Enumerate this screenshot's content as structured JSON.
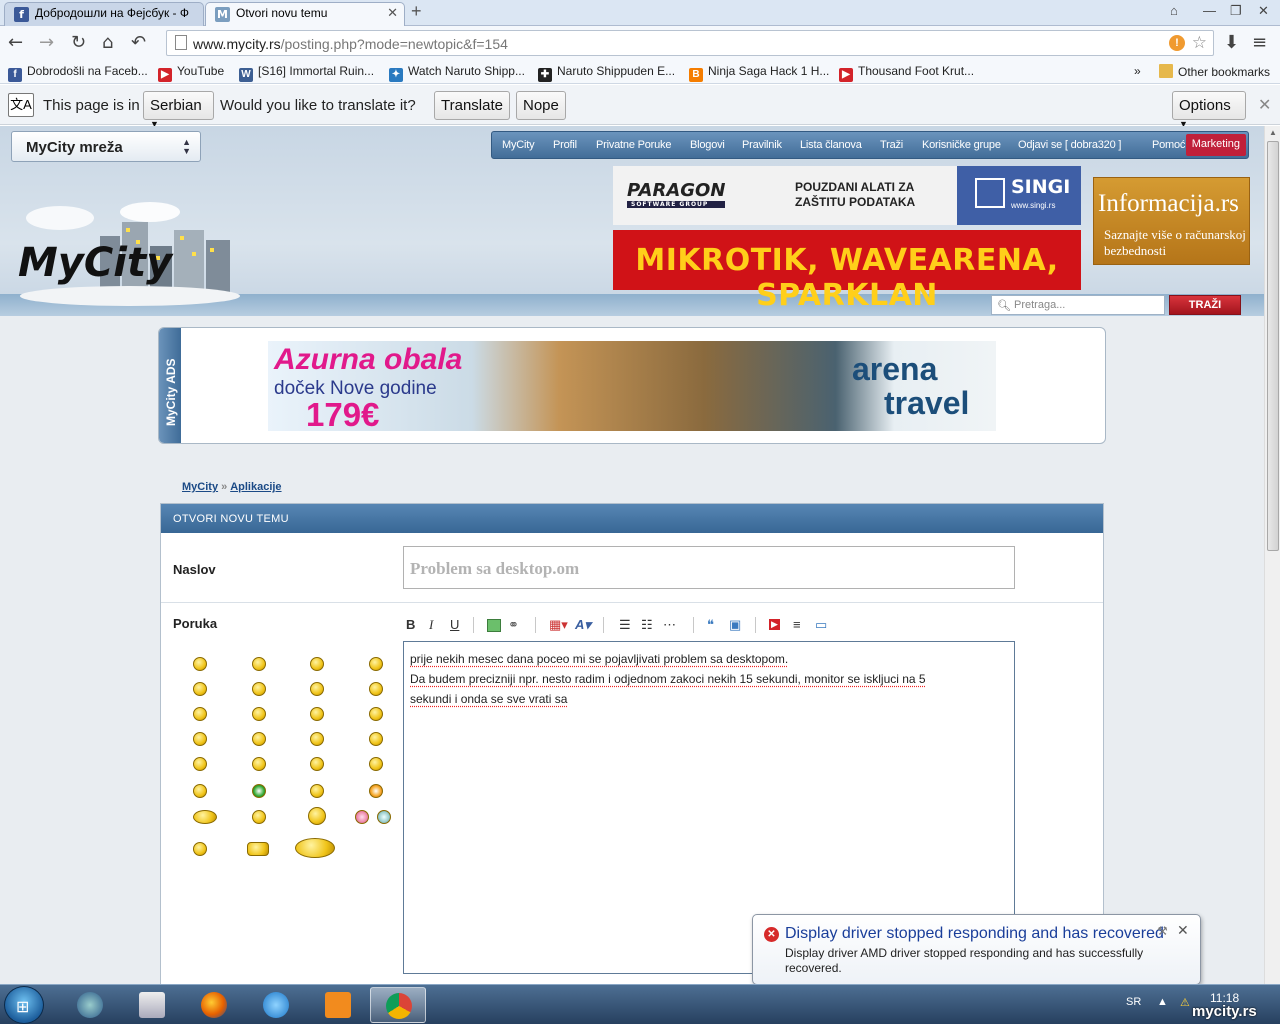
{
  "tabs": [
    {
      "label": "Добродошли на Фејсбук - Ф",
      "favicon": "f"
    },
    {
      "label": "Otvori novu temu",
      "favicon": "M"
    }
  ],
  "omnibox": {
    "host": "www.mycity.rs",
    "path": "/posting.php?mode=newtopic&f=154"
  },
  "bookmarks": [
    {
      "label": "Dobrodošli na Faceb...",
      "icon": "facebook-icon"
    },
    {
      "label": "YouTube",
      "icon": "youtube-icon"
    },
    {
      "label": "[S16] Immortal Ruin...",
      "icon": "wordpress-icon"
    },
    {
      "label": "Watch Naruto Shipp...",
      "icon": "puzzle-icon"
    },
    {
      "label": "Naruto Shippuden E...",
      "icon": "naruto-icon"
    },
    {
      "label": "Ninja Saga Hack 1 H...",
      "icon": "blogger-icon"
    },
    {
      "label": "Thousand Foot Krut...",
      "icon": "youtube-icon"
    }
  ],
  "bookmarks_more": "»",
  "other_bookmarks": "Other bookmarks",
  "translate_bar": {
    "prefix": "This page is in",
    "language": "Serbian",
    "question": "Would you like to translate it?",
    "translate_label": "Translate",
    "nope_label": "Nope",
    "options_label": "Options"
  },
  "site": {
    "network_select": "MyCity mreža",
    "nav": [
      "MyCity",
      "Profil",
      "Privatne Poruke",
      "Blogovi",
      "Pravilnik",
      "Lista članova",
      "Traži",
      "Korisničke grupe",
      "Odjavi se [ dobra320 ]",
      "Pomoć"
    ],
    "nav_marketing": "Marketing",
    "logo_text": "MyCity",
    "ad_paragon": {
      "brand": "PARAGON",
      "sub": "SOFTWARE GROUP",
      "text": "POUZDANI ALATI ZA ZAŠTITU PODATAKA",
      "singi": "SINGI",
      "singi_url": "www.singi.rs"
    },
    "ad_mikrotik": "MIKROTIK, WAVEARENA, SPARKLAN",
    "ad_info": {
      "title": "Informacija.rs",
      "text": "Saznajte više o računarskoj bezbednosti"
    },
    "search_placeholder": "Pretraga...",
    "search_button": "TRAŽI",
    "ads_label": "MyCity ADS",
    "ad_azurna": {
      "line1": "Azurna obala",
      "line2": "doček Nove godine",
      "price": "179€",
      "brand1": "arena",
      "brand2": "travel"
    }
  },
  "breadcrumb": {
    "root": "MyCity",
    "separator": "»",
    "current": "Aplikacije"
  },
  "form": {
    "header": "OTVORI NOVU TEMU",
    "title_label": "Naslov",
    "title_value": "Problem sa desktop.om",
    "message_label": "Poruka",
    "message_lines": [
      "prije nekih mesec dana poceo mi se pojavljivati problem sa desktopom.",
      "Da budem precizniji npr. nesto radim i odjednom zakoci nekih 15 sekundi, monitor se iskljuci na 5",
      "sekundi i onda se sve vrati sa"
    ],
    "toolbar_tooltips": {
      "bold": "B",
      "italic": "I",
      "underline": "U"
    }
  },
  "balloon": {
    "title": "Display driver stopped responding and has recovered",
    "message": "Display driver AMD driver stopped responding and has successfully recovered."
  },
  "taskbar": {
    "lang": "SR",
    "time": "11:18",
    "watermark": "mycity.rs"
  }
}
